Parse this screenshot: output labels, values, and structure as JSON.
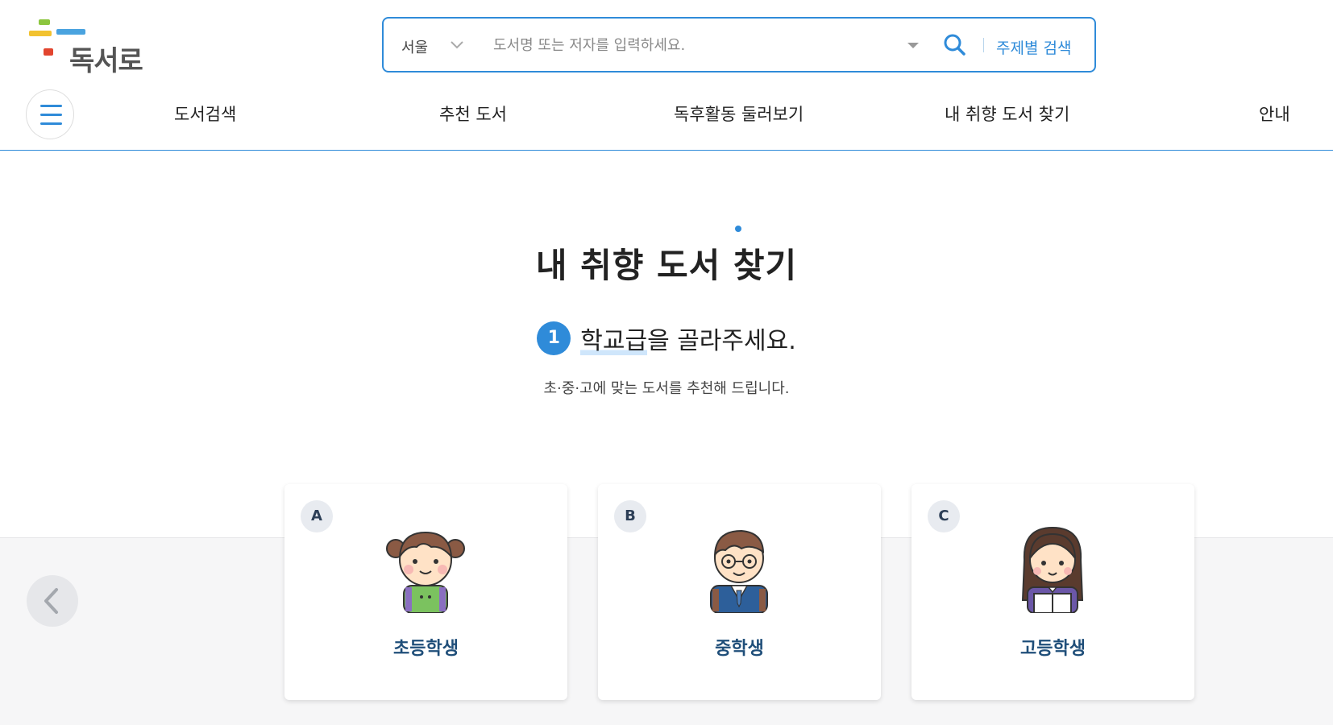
{
  "logo": {
    "text": "독서로"
  },
  "search": {
    "region": "서울",
    "placeholder": "도서명 또는 저자를 입력하세요.",
    "topic_search_label": "주제별 검색"
  },
  "nav": {
    "items": [
      {
        "label": "도서검색"
      },
      {
        "label": "추천 도서"
      },
      {
        "label": "독후활동 둘러보기"
      },
      {
        "label": "내 취향 도서 찾기"
      },
      {
        "label": "안내"
      }
    ]
  },
  "main": {
    "title": "내 취향 도서 찾기",
    "step_number": "1",
    "step_highlight": "학교급",
    "step_rest": "을 골라주세요.",
    "subtitle": "초·중·고에 맞는 도서를 추천해 드립니다."
  },
  "cards": [
    {
      "badge": "A",
      "label": "초등학생",
      "icon": "elementary-student-icon"
    },
    {
      "badge": "B",
      "label": "중학생",
      "icon": "middle-school-student-icon"
    },
    {
      "badge": "C",
      "label": "고등학생",
      "icon": "high-school-student-icon"
    }
  ],
  "colors": {
    "accent": "#2f8bd9",
    "card_label": "#1f4e79",
    "band": "#f6f6f7"
  }
}
